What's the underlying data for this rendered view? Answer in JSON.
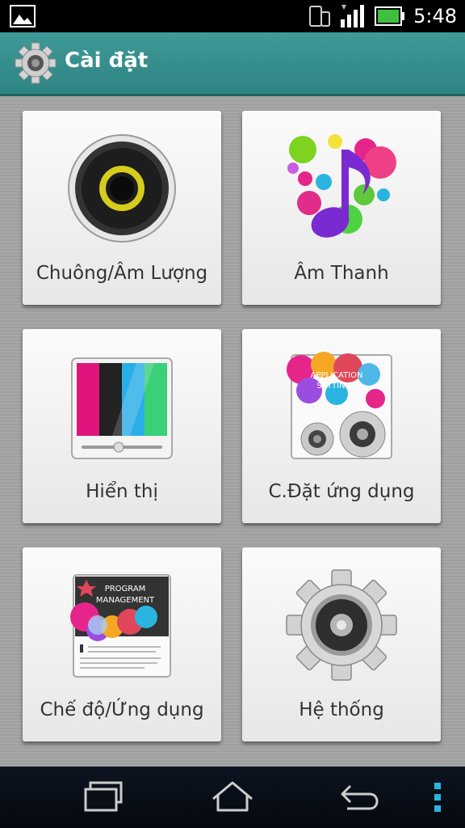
{
  "status_bar": {
    "time": "5:48",
    "icons": [
      "image-notification-icon",
      "phone-vibrate-icon",
      "signal-icon",
      "battery-icon"
    ]
  },
  "action_bar": {
    "title": "Cài đặt",
    "icon": "settings-gear-icon",
    "color": "#37908e"
  },
  "tiles": [
    {
      "label": "Chuông/Âm Lượng",
      "icon": "speaker-icon"
    },
    {
      "label": "Âm Thanh",
      "icon": "music-note-icon"
    },
    {
      "label": "Hiển thị",
      "icon": "display-icon"
    },
    {
      "label": "C.Đặt ứng dụng",
      "icon": "app-settings-icon",
      "art_text": [
        "APPLICATION",
        "SETTINGS"
      ]
    },
    {
      "label": "Chế độ/Ứng dụng",
      "icon": "program-management-icon",
      "art_text": [
        "PROGRAM",
        "MANAGEMENT"
      ]
    },
    {
      "label": "Hệ thống",
      "icon": "system-gear-icon"
    }
  ],
  "nav_bar": {
    "buttons": [
      "recent-apps-icon",
      "home-icon",
      "back-icon",
      "menu-icon"
    ]
  }
}
